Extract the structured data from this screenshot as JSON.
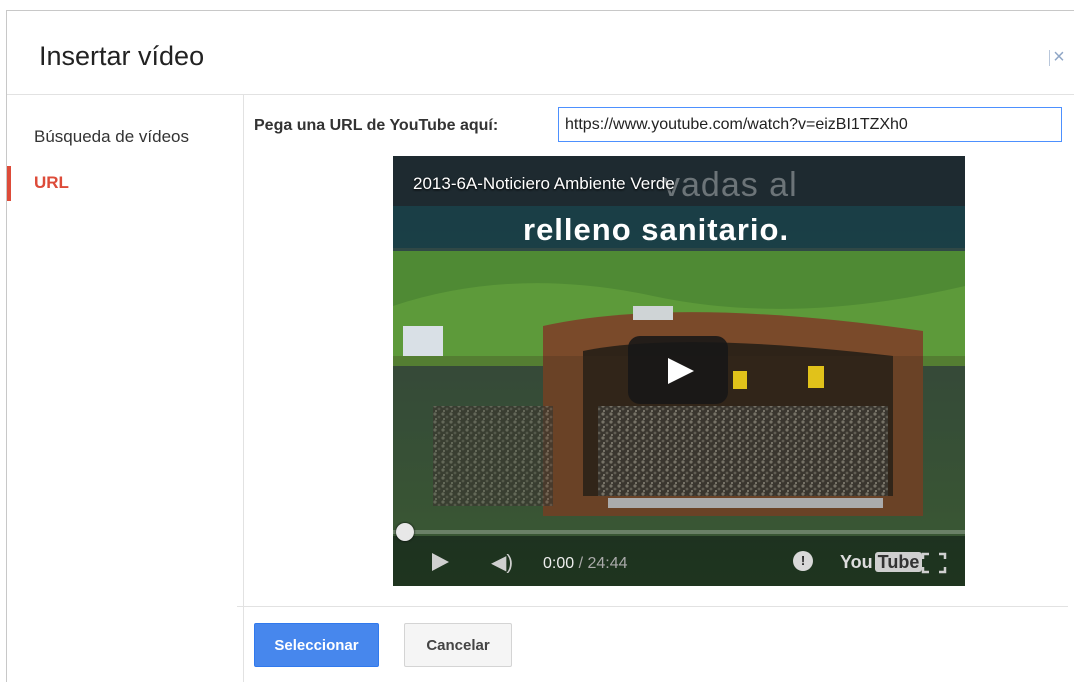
{
  "dialog": {
    "title": "Insertar vídeo",
    "close_icon": "close-icon"
  },
  "sidebar": {
    "items": [
      {
        "label": "Búsqueda de vídeos",
        "selected": false
      },
      {
        "label": "URL",
        "selected": true
      }
    ],
    "accent_color": "#dd4b39"
  },
  "url_form": {
    "label": "Pega una URL de YouTube aquí:",
    "value": "https://www.youtube.com/watch?v=eizBI1TZXh0",
    "focus_color": "#4d90fe"
  },
  "video": {
    "title": "2013-6A-Noticiero Ambiente Verde",
    "overlay_ghost": "vadas al",
    "banner": "relleno sanitario.",
    "current_time": "0:00",
    "duration": "/ 24:44",
    "progress": 0,
    "icons": [
      "play-icon",
      "volume-icon",
      "info-icon",
      "youtube-logo",
      "fullscreen-icon"
    ],
    "logo_text_a": "You",
    "logo_text_b": "Tube"
  },
  "footer": {
    "select_label": "Seleccionar",
    "cancel_label": "Cancelar",
    "primary_color": "#4787ed"
  }
}
